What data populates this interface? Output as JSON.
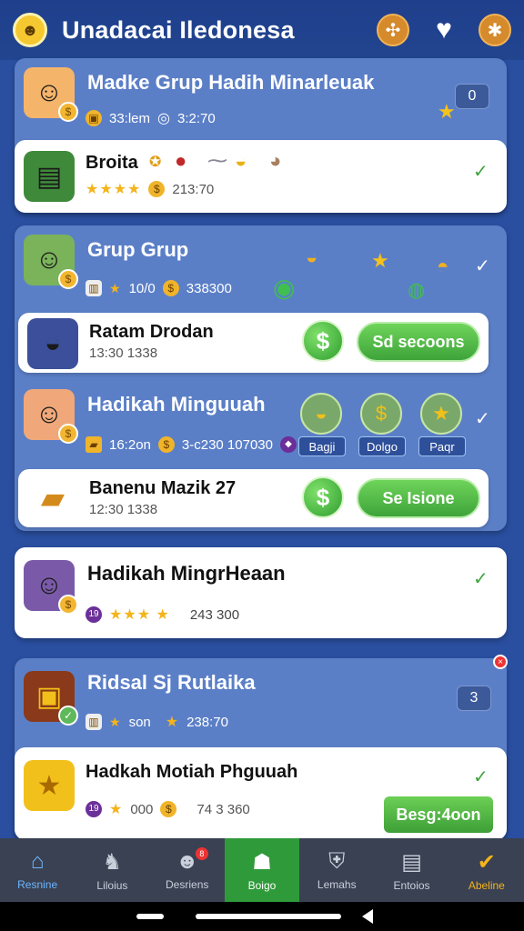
{
  "header": {
    "title": "Unadacai Iledonesa",
    "icons": [
      "logo-icon",
      "puzzle-icon",
      "heart-icon",
      "bug-icon"
    ]
  },
  "card1": {
    "title": "Madke Grup Hadih Minarleuak",
    "meta_a": "33:lem",
    "meta_b": "3:2:70",
    "count": "0",
    "inner": {
      "title": "Broita",
      "sub": "213:70"
    }
  },
  "card2": {
    "title": "Grup Grup",
    "meta_a": "10/0",
    "meta_b": "338300",
    "inner1": {
      "title": "Ratam Drodan",
      "sub": "13:30 1338",
      "button": "Sd secoons"
    },
    "row2": {
      "title": "Hadikah Minguuah",
      "meta_a": "16:2on",
      "meta_b": "3-c230 107030",
      "labels": [
        "Bagji",
        "Dolgo",
        "Paqr"
      ]
    },
    "inner2": {
      "title": "Banenu Mazik 27",
      "sub": "12:30 1338",
      "button": "Se Isione"
    }
  },
  "card3": {
    "title": "Hadikah MingrHeaan",
    "meta_badge": "19",
    "meta_b": "243 300"
  },
  "card4": {
    "title": "Ridsal Sj Rutlaika",
    "meta_a": "son",
    "meta_b": "238:70",
    "count": "3",
    "inner": {
      "title": "Hadkah Motiah Phguuah",
      "meta_badge": "19",
      "meta_a": "000",
      "meta_b": "74 3 360",
      "button": "Besg:4oon"
    }
  },
  "nav": [
    {
      "label": "Resnine",
      "icon": "home-icon"
    },
    {
      "label": "Liloius",
      "icon": "cat-icon"
    },
    {
      "label": "Desriens",
      "icon": "people-icon"
    },
    {
      "label": "Boigo",
      "icon": "robot-icon"
    },
    {
      "label": "Lemahs",
      "icon": "shield-icon"
    },
    {
      "label": "Entoios",
      "icon": "chat-icon"
    },
    {
      "label": "Abeline",
      "icon": "check-icon"
    }
  ],
  "nav_badge": "8",
  "colors": {
    "primary": "#2a4fa0",
    "card": "#5b7fc7",
    "accent_green": "#3ea43a",
    "gold": "#f4b41a"
  }
}
